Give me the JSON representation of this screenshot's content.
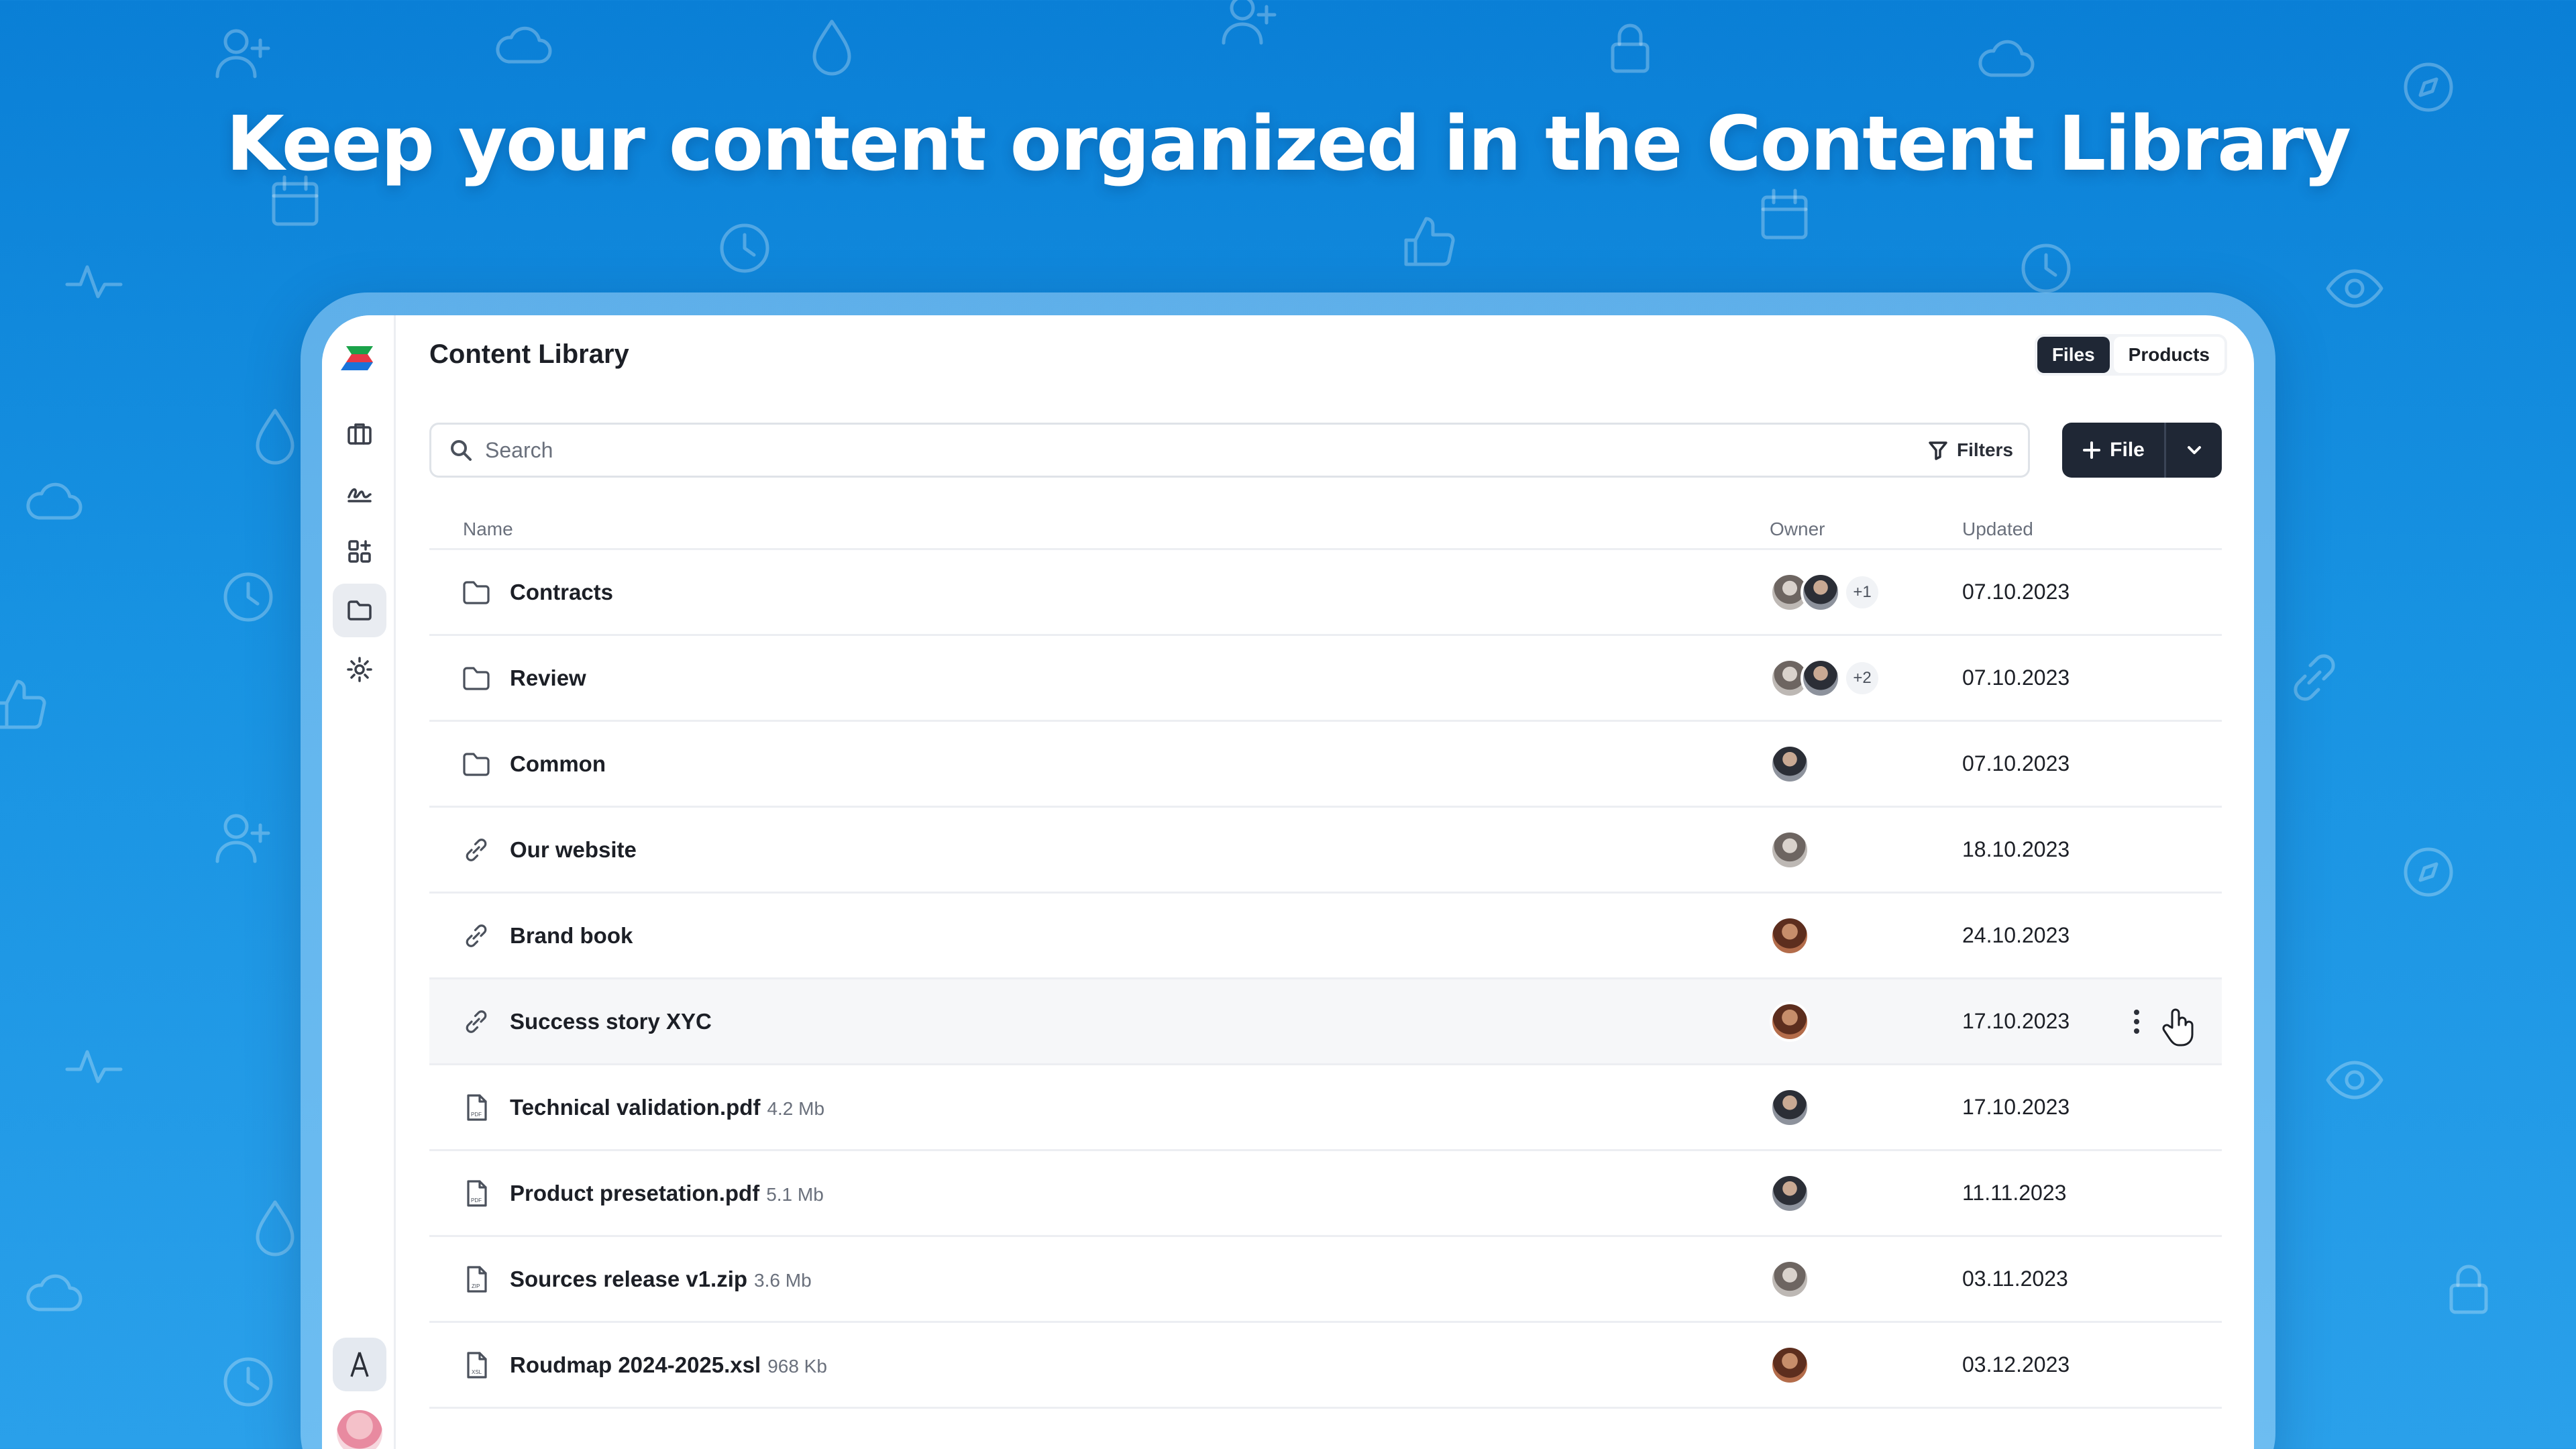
{
  "headline": "Keep your content organized in the Content Library",
  "app": {
    "title": "Content Library",
    "tabs": [
      {
        "label": "Files",
        "active": true
      },
      {
        "label": "Products",
        "active": false
      }
    ],
    "search": {
      "placeholder": "Search",
      "value": ""
    },
    "filters_label": "Filters",
    "add_file_label": "File"
  },
  "sidebar": {
    "items": [
      {
        "icon": "briefcase-icon",
        "active": false
      },
      {
        "icon": "signature-icon",
        "active": false
      },
      {
        "icon": "apps-icon",
        "active": false
      },
      {
        "icon": "folder-icon",
        "active": true
      },
      {
        "icon": "gear-icon",
        "active": false
      }
    ],
    "bottom": [
      {
        "icon": "launch-icon"
      },
      {
        "icon": "user-avatar"
      }
    ]
  },
  "table": {
    "columns": {
      "name": "Name",
      "owner": "Owner",
      "updated": "Updated"
    },
    "rows": [
      {
        "type": "folder",
        "name": "Contracts",
        "size": "",
        "owners": [
          "a1",
          "a2"
        ],
        "extra": "+1",
        "updated": "07.10.2023"
      },
      {
        "type": "folder",
        "name": "Review",
        "size": "",
        "owners": [
          "a1",
          "a2"
        ],
        "extra": "+2",
        "updated": "07.10.2023"
      },
      {
        "type": "folder",
        "name": "Common",
        "size": "",
        "owners": [
          "a2"
        ],
        "extra": "",
        "updated": "07.10.2023"
      },
      {
        "type": "link",
        "name": "Our website",
        "size": "",
        "owners": [
          "a1"
        ],
        "extra": "",
        "updated": "18.10.2023"
      },
      {
        "type": "link",
        "name": "Brand book",
        "size": "",
        "owners": [
          "a3"
        ],
        "extra": "",
        "updated": "24.10.2023"
      },
      {
        "type": "link",
        "name": "Success story XYC",
        "size": "",
        "owners": [
          "a3"
        ],
        "extra": "",
        "updated": "17.10.2023",
        "hover": true
      },
      {
        "type": "pdf",
        "name": "Technical validation.pdf",
        "size": "4.2 Mb",
        "owners": [
          "a2"
        ],
        "extra": "",
        "updated": "17.10.2023"
      },
      {
        "type": "pdf",
        "name": "Product presetation.pdf",
        "size": "5.1 Mb",
        "owners": [
          "a2"
        ],
        "extra": "",
        "updated": "11.11.2023"
      },
      {
        "type": "zip",
        "name": "Sources release v1.zip",
        "size": "3.6 Mb",
        "owners": [
          "a1"
        ],
        "extra": "",
        "updated": "03.11.2023"
      },
      {
        "type": "xsl",
        "name": "Roudmap 2024-2025.xsl",
        "size": "968 Kb",
        "owners": [
          "a3"
        ],
        "extra": "",
        "updated": "03.12.2023"
      }
    ]
  },
  "colors": {
    "background": "#1893e2",
    "primary": "#1f2735"
  }
}
